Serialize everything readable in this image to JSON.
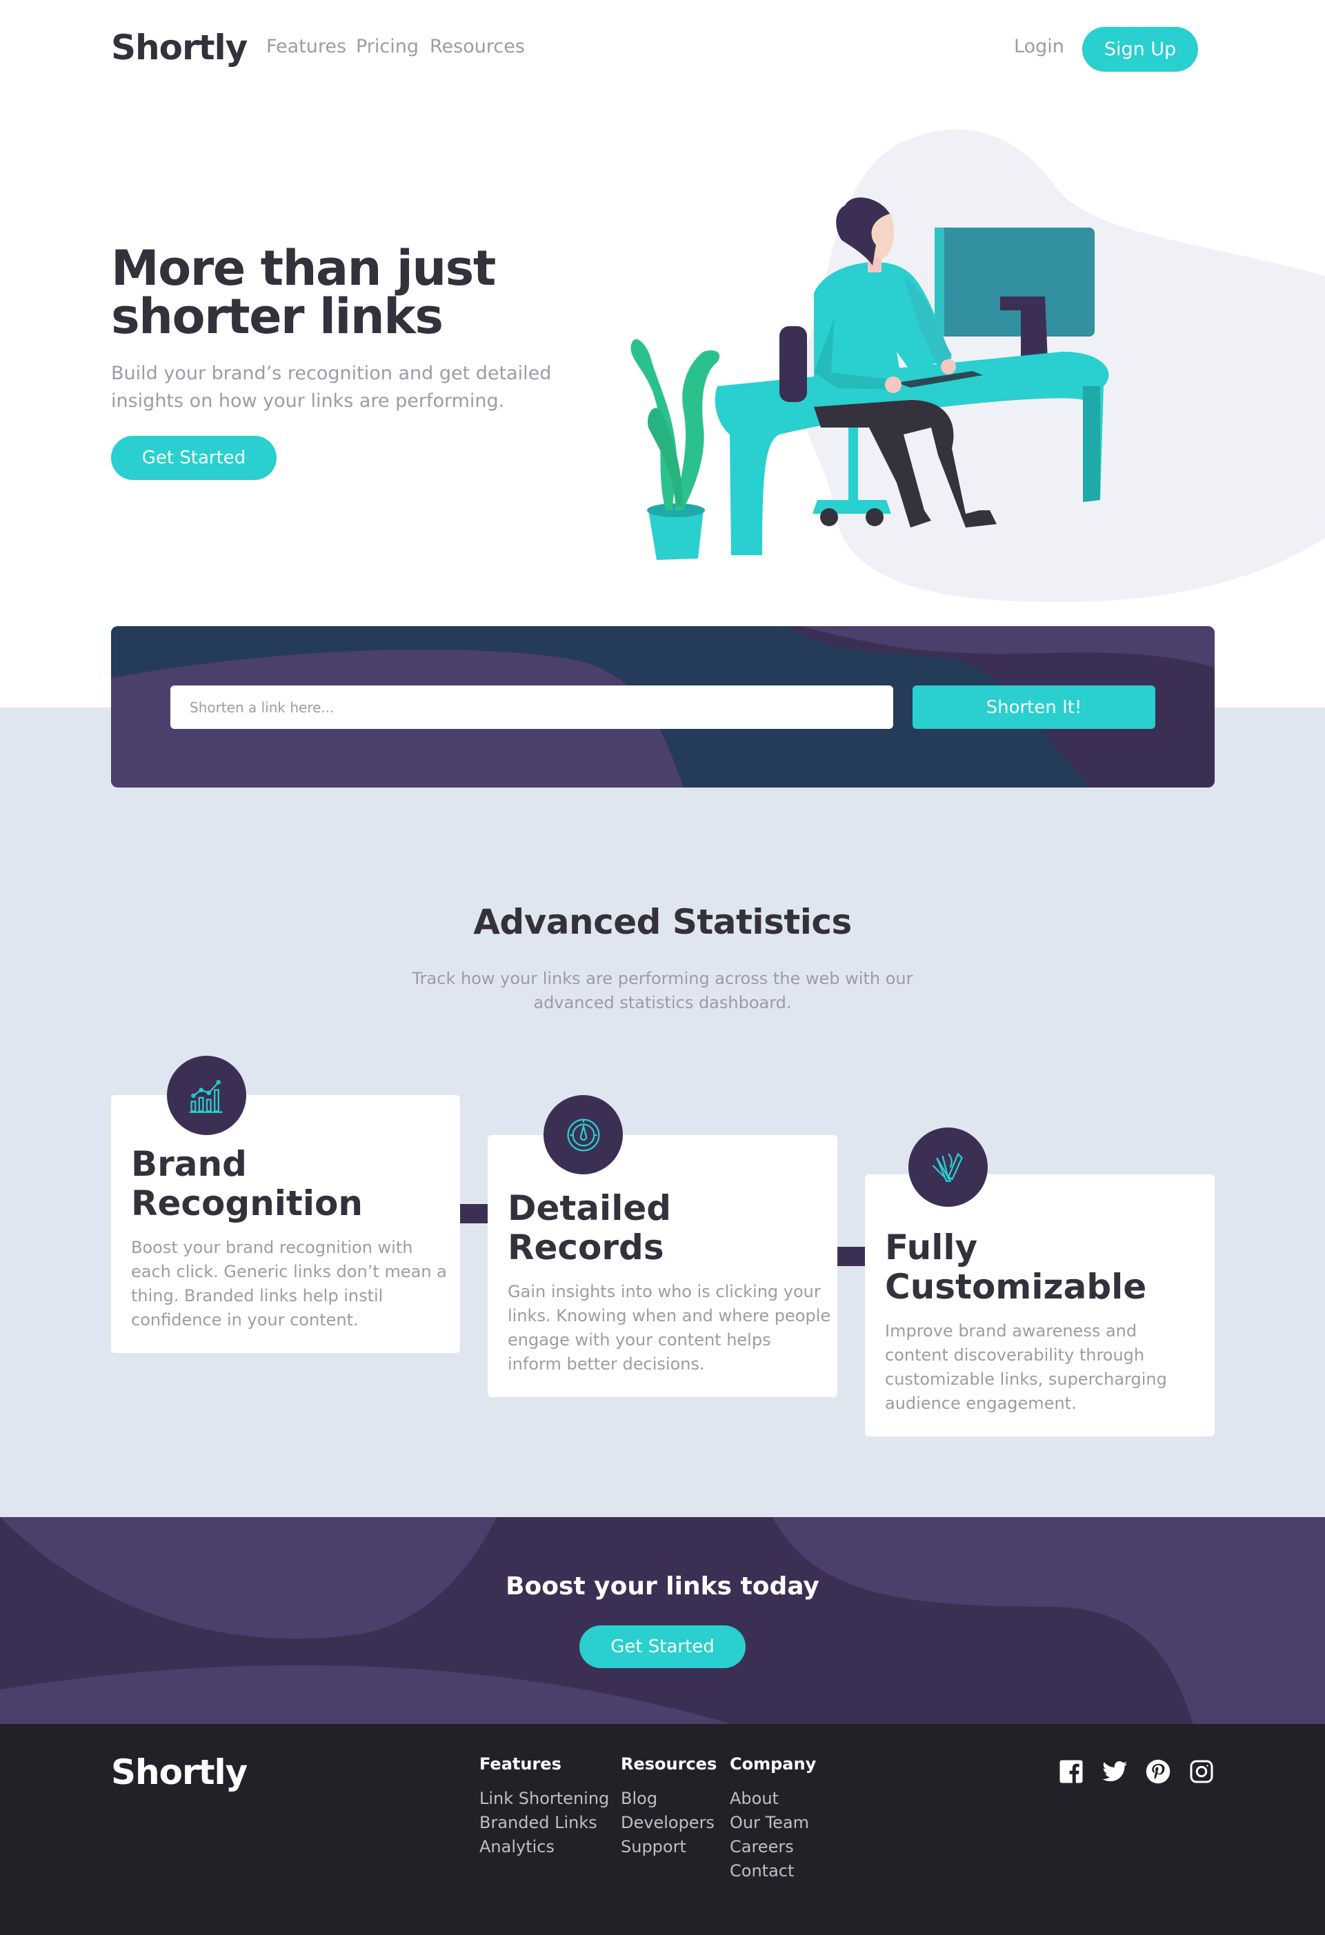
{
  "brand": {
    "logo": "Shortly"
  },
  "nav": {
    "links": [
      "Features",
      "Pricing",
      "Resources"
    ],
    "login": "Login",
    "signup": "Sign Up"
  },
  "hero": {
    "title_line1": "More than just",
    "title_line2": "shorter links",
    "subtitle_line1": "Build your brand’s recognition and get detailed",
    "subtitle_line2": "insights on how your links are performing.",
    "cta": "Get Started"
  },
  "shorten": {
    "placeholder": "Shorten a link here...",
    "button": "Shorten It!"
  },
  "statistics": {
    "title": "Advanced Statistics",
    "subtitle_line1": "Track how your links are performing across the web with our",
    "subtitle_line2": "advanced statistics dashboard.",
    "cards": [
      {
        "icon": "chart-icon",
        "title_line1": "Brand",
        "title_line2": "Recognition",
        "lines": [
          "Boost your brand recognition with",
          "each click. Generic links don’t mean a",
          "thing. Branded links help instil",
          "confidence in your content."
        ]
      },
      {
        "icon": "gauge-icon",
        "title_line1": "Detailed",
        "title_line2": "Records",
        "lines": [
          "Gain insights into who is clicking your",
          "links. Knowing when and where people",
          "engage with your content helps",
          "inform better decisions."
        ]
      },
      {
        "icon": "brushes-icon",
        "title_line1": "Fully",
        "title_line2": "Customizable",
        "lines": [
          "Improve brand awareness and",
          "content discoverability through",
          "customizable links, supercharging",
          "audience engagement."
        ]
      }
    ]
  },
  "boost": {
    "title": "Boost your links today",
    "cta": "Get Started"
  },
  "footer": {
    "logo": "Shortly",
    "columns": [
      {
        "title": "Features",
        "links": [
          "Link Shortening",
          "Branded Links",
          "Analytics"
        ]
      },
      {
        "title": "Resources",
        "links": [
          "Blog",
          "Developers",
          "Support"
        ]
      },
      {
        "title": "Company",
        "links": [
          "About",
          "Our Team",
          "Careers",
          "Contact"
        ]
      }
    ],
    "social": [
      "facebook-icon",
      "twitter-icon",
      "pinterest-icon",
      "instagram-icon"
    ]
  },
  "colors": {
    "cyan": "#2acfcf",
    "dark_violet": "#3b3054",
    "very_dark_blue": "#35323e",
    "gray": "#9e9aa7",
    "stats_bg": "#e0e6ef",
    "footer_bg": "#232127"
  }
}
